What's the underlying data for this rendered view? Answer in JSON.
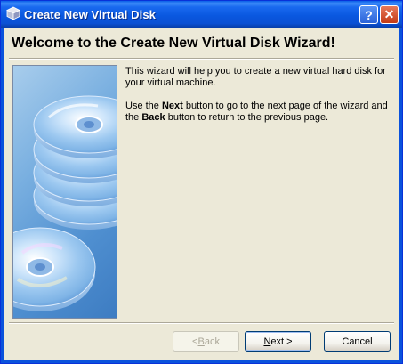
{
  "window": {
    "title": "Create New Virtual Disk",
    "help_label": "?",
    "close_label": "✕"
  },
  "header": {
    "title": "Welcome to the Create New Virtual Disk Wizard!"
  },
  "body": {
    "para1": "This wizard will help you to create a new virtual hard disk for your virtual machine.",
    "para2_pre": "Use the ",
    "para2_next": "Next",
    "para2_mid": " button to go to the next page of the wizard and the ",
    "para2_back": "Back",
    "para2_post": " button to return to the previous page."
  },
  "buttons": {
    "back_prefix": "< ",
    "back_hotkey": "B",
    "back_rest": "ack",
    "next_hotkey": "N",
    "next_rest": "ext >",
    "cancel": "Cancel",
    "back_enabled": false
  },
  "icons": {
    "app": "virtualbox-cube-icon",
    "help": "help-icon",
    "close": "close-icon",
    "side": "disk-stack-illustration"
  },
  "colors": {
    "titlebar": "#0a58e0",
    "close": "#c33a14",
    "dialog_bg": "#ece9d8"
  }
}
